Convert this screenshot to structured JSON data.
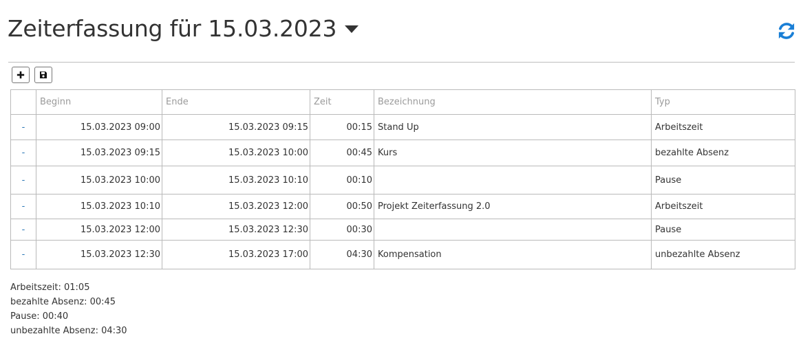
{
  "header": {
    "title": "Zeiterfassung für 15.03.2023",
    "caret_icon": "caret-down-icon",
    "refresh_icon": "refresh-icon",
    "refresh_color": "#1a7fd6"
  },
  "toolbar": {
    "add_icon": "plus-icon",
    "save_icon": "floppy-disk-icon"
  },
  "table": {
    "columns": [
      "",
      "Beginn",
      "Ende",
      "Zeit",
      "Bezeichnung",
      "Typ"
    ],
    "rows": [
      {
        "action": "-",
        "beginn": "15.03.2023 09:00",
        "ende": "15.03.2023 09:15",
        "zeit": "00:15",
        "bezeichnung": "Stand Up",
        "typ": "Arbeitszeit"
      },
      {
        "action": "-",
        "beginn": "15.03.2023 09:15",
        "ende": "15.03.2023 10:00",
        "zeit": "00:45",
        "bezeichnung": "Kurs",
        "typ": "bezahlte Absenz"
      },
      {
        "action": "-",
        "beginn": "15.03.2023 10:00",
        "ende": "15.03.2023 10:10",
        "zeit": "00:10",
        "bezeichnung": "",
        "typ": "Pause"
      },
      {
        "action": "-",
        "beginn": "15.03.2023 10:10",
        "ende": "15.03.2023 12:00",
        "zeit": "00:50",
        "bezeichnung": "Projekt Zeiterfassung 2.0",
        "typ": "Arbeitszeit"
      },
      {
        "action": "-",
        "beginn": "15.03.2023 12:00",
        "ende": "15.03.2023 12:30",
        "zeit": "00:30",
        "bezeichnung": "",
        "typ": "Pause"
      },
      {
        "action": "-",
        "beginn": "15.03.2023 12:30",
        "ende": "15.03.2023 17:00",
        "zeit": "04:30",
        "bezeichnung": "Kompensation",
        "typ": "unbezahlte Absenz"
      }
    ]
  },
  "summary": [
    "Arbeitszeit: 01:05",
    "bezahlte Absenz: 00:45",
    "Pause: 00:40",
    "unbezahlte Absenz: 04:30"
  ]
}
